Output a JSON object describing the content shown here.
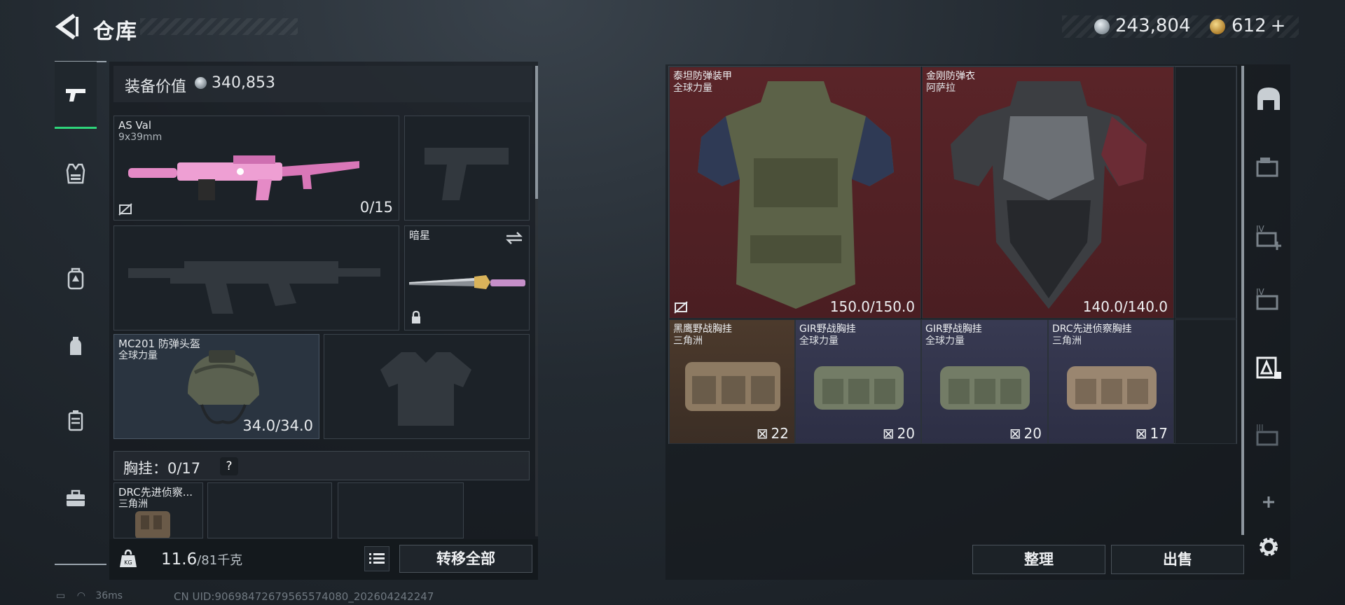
{
  "header": {
    "title": "仓库",
    "currency1_value": "243,804",
    "currency2_value": "612",
    "currency2_add": "+"
  },
  "rail": {
    "items": [
      "pistol-icon",
      "vest-icon",
      "backpack-icon",
      "pouch-icon",
      "case-icon",
      "toolbox-icon"
    ]
  },
  "loadout": {
    "value_label": "装备价值",
    "value": "340,853",
    "primary": {
      "name": "AS Val",
      "caliber": "9x39mm",
      "ammo": "0/15"
    },
    "melee": {
      "name": "暗星"
    },
    "helmet": {
      "name": "MC201 防弹头盔",
      "faction": "全球力量",
      "durability": "34.0/34.0"
    },
    "chest": {
      "label": "胸挂：",
      "count": "0/17",
      "help": "?"
    },
    "chest_item": {
      "name": "DRC先进侦察...",
      "faction": "三角洲"
    },
    "weight_value": "11.6",
    "weight_max": "/81千克",
    "transfer_label": "转移全部"
  },
  "storage": {
    "armor": [
      {
        "name": "泰坦防弹装甲",
        "faction": "全球力量",
        "durability": "150.0/150.0",
        "rarity_color": "#5a2428"
      },
      {
        "name": "金刚防弹衣",
        "faction": "阿萨拉",
        "durability": "140.0/140.0",
        "rarity_color": "#5a2428"
      }
    ],
    "rigs": [
      {
        "name": "黑鹰野战胸挂",
        "faction": "三角洲",
        "capacity": "22",
        "rarity_color": "#4c3a2c"
      },
      {
        "name": "GIR野战胸挂",
        "faction": "全球力量",
        "capacity": "20",
        "rarity_color": "#383a52"
      },
      {
        "name": "GIR野战胸挂",
        "faction": "全球力量",
        "capacity": "20",
        "rarity_color": "#383a52"
      },
      {
        "name": "DRC先进侦察胸挂",
        "faction": "三角洲",
        "capacity": "17",
        "rarity_color": "#383a52"
      }
    ],
    "sort_label": "整理",
    "sell_label": "出售"
  },
  "status_bar": {
    "ping": "36ms",
    "uid": "CN UID:9069847267956557408​0_202604242247"
  }
}
